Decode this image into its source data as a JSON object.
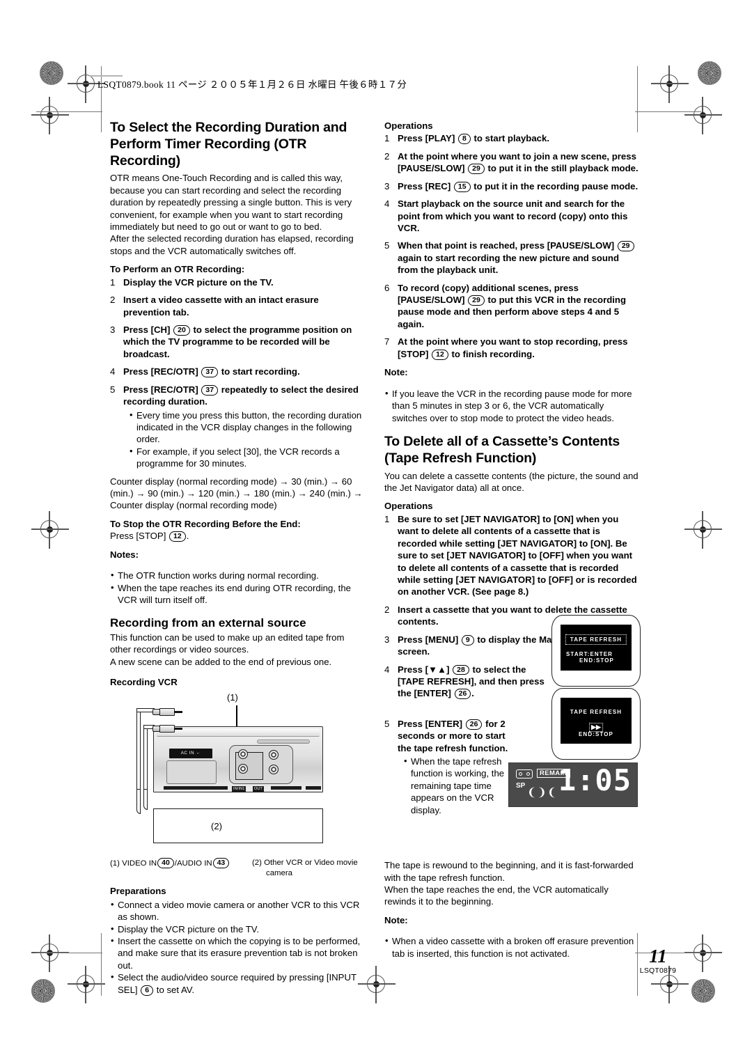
{
  "page_header": "LSQT0879.book   11 ページ   ２００５年１月２６日   水曜日   午後６時１７分",
  "left_column": {
    "heading": "To Select the Recording Duration and Perform Timer Recording (OTR Recording)",
    "intro_1": "OTR means One-Touch Recording and is called this way, because you can start recording and select the recording duration by repeatedly pressing a single button. This is very convenient, for example when you want to start recording immediately but need to go out or want to go to bed.",
    "intro_2": "After the selected recording duration has elapsed, recording stops and the VCR automatically switches off.",
    "perform_lead": "To Perform an OTR Recording:",
    "steps": [
      {
        "num": "1",
        "text": "Display the VCR picture on the TV."
      },
      {
        "num": "2",
        "text": "Insert a video cassette with an intact erasure prevention tab."
      },
      {
        "num": "3",
        "pre": "Press [CH]",
        "ref": "20",
        "post": "to select the programme position on which the TV programme to be recorded will be broadcast."
      },
      {
        "num": "4",
        "pre": "Press [REC/OTR]",
        "ref": "37",
        "post": "to start recording."
      },
      {
        "num": "5",
        "pre": "Press [REC/OTR]",
        "ref": "37",
        "post": "repeatedly to select the desired recording duration."
      }
    ],
    "step5_bullets": [
      "Every time you press this button, the recording duration indicated in the VCR display changes in the following order.",
      "For example, if you select [30], the VCR records a programme for 30 minutes."
    ],
    "duration_order": "Counter display (normal recording mode) → 30 (min.) → 60 (min.) → 90 (min.) → 120 (min.) → 180 (min.) → 240 (min.) → Counter display (normal recording mode)",
    "stop_lead": "To Stop the OTR Recording Before the End:",
    "stop_pre": "Press [STOP]",
    "stop_ref": "12",
    "stop_post": ".",
    "notes_label": "Notes:",
    "notes": [
      "The OTR function works during normal recording.",
      "When the tape reaches its end during OTR recording, the VCR will turn itself off."
    ],
    "ext_heading": "Recording from an external source",
    "ext_p1": "This function can be used to make up an edited tape from other recordings or video sources.",
    "ext_p2": "A new scene can be added to the end of previous one.",
    "diagram": {
      "title": "Recording VCR",
      "callout_1": "(1)",
      "callout_2": "(2)",
      "ac_in_label": "AC IN ←",
      "jack_in_label": "IN/IN1",
      "jack_out_label": "OUT",
      "caption_1_num": "(1)",
      "caption_1_a": "VIDEO IN",
      "caption_1_ref_a": "40",
      "caption_1_b": "/AUDIO IN",
      "caption_1_ref_b": "43",
      "caption_2_num": "(2)",
      "caption_2_text": "Other VCR or Video movie",
      "caption_2_text2": "camera"
    },
    "prep_label": "Preparations",
    "prep_bullets": [
      "Connect a video movie camera or another VCR to this VCR as shown.",
      "Display the VCR picture on the TV.",
      "Insert the cassette on which the copying is to be performed, and make sure that its erasure prevention tab is not broken out."
    ],
    "prep_last_pre": "Select the audio/video source required by pressing [INPUT SEL]",
    "prep_last_ref": "6",
    "prep_last_post": "to set AV."
  },
  "right_column": {
    "operations_label_1": "Operations",
    "operations_1": [
      {
        "num": "1",
        "pre": "Press [PLAY]",
        "ref": "8",
        "post": "to start playback."
      },
      {
        "num": "2",
        "pre": "At the point where you want to join a new scene, press [PAUSE/SLOW]",
        "ref": "29",
        "post": "to put it in the still playback mode."
      },
      {
        "num": "3",
        "pre": "Press [REC]",
        "ref": "15",
        "post": "to put it in the recording pause mode."
      },
      {
        "num": "4",
        "pre": "Start playback on the source unit and search for the point from which you want to record (copy) onto this VCR.",
        "ref": "",
        "post": ""
      },
      {
        "num": "5",
        "pre": "When that point is reached, press [PAUSE/SLOW]",
        "ref": "29",
        "post": "again to start recording the new picture and sound from the playback unit."
      },
      {
        "num": "6",
        "pre": "To record (copy) additional scenes, press [PAUSE/SLOW]",
        "ref": "29",
        "post": "to put this VCR in the recording pause mode and then perform above steps 4 and 5 again."
      },
      {
        "num": "7",
        "pre": "At the point where you want to stop recording, press [STOP]",
        "ref": "12",
        "post": "to finish recording."
      }
    ],
    "note_label_1": "Note:",
    "note_1": "If you leave the VCR in the recording pause mode for more than 5 minutes in step 3 or 6, the VCR automatically switches over to stop mode to protect the video heads.",
    "delete_heading": "To Delete all of a Cassette’s Contents (Tape Refresh Function)",
    "delete_intro": "You can delete a cassette contents (the picture, the sound and the Jet Navigator data) all at once.",
    "operations_label_2": "Operations",
    "operations_2": [
      {
        "num": "1",
        "pre": "Be sure to set [JET NAVIGATOR] to [ON] when you want to delete all contents of a cassette that is recorded while setting [JET NAVIGATOR] to [ON]. Be sure to set [JET NAVIGATOR] to [OFF] when you want to delete all contents of a cassette that is recorded while setting [JET NAVIGATOR] to [OFF] or is recorded on another VCR. (See page 8.)",
        "ref": "",
        "post": ""
      },
      {
        "num": "2",
        "pre": "Insert a cassette that you want to delete the cassette contents.",
        "ref": "",
        "post": ""
      },
      {
        "num": "3",
        "pre": "Press [MENU]",
        "ref": "9",
        "post": "to display the Main menu on the screen."
      },
      {
        "num": "4",
        "pre": "Press [▼▲]",
        "ref": "28",
        "post": "to select the [TAPE REFRESH], and then press the [ENTER]",
        "ref2": "26",
        "post2": "."
      },
      {
        "num": "5",
        "pre": "Press [ENTER]",
        "ref": "26",
        "post": "for 2 seconds or more to start the tape refresh function."
      }
    ],
    "step5_bullet": "When the tape refresh function is working, the remaining tape time appears on the VCR display.",
    "tv_figure_1": {
      "osd_title": "TAPE REFRESH",
      "osd_line_1": "START:ENTER",
      "osd_line_2": "END:STOP"
    },
    "tv_figure_2": {
      "osd_title": "TAPE REFRESH",
      "osd_icon": "▶▶",
      "osd_line": "END:STOP"
    },
    "vcr_display": {
      "remain_label": "REMAIN",
      "speed_label": "SP",
      "time": "1:05"
    },
    "closing_1": "The tape is rewound to the beginning, and it is fast-forwarded with the tape refresh function.",
    "closing_2": "When the tape reaches the end, the VCR automatically rewinds it to the beginning.",
    "note_label_2": "Note:",
    "note_2": "When a video cassette with a broken off erasure prevention tab is inserted, this function is not activated."
  },
  "footer": {
    "page_number": "11",
    "doc_code": "LSQT0879"
  }
}
